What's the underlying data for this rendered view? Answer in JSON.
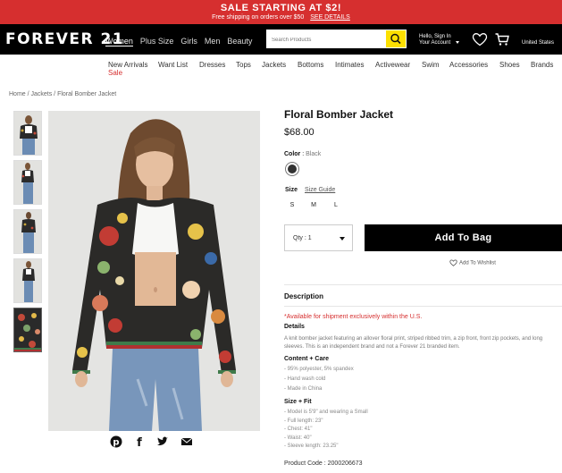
{
  "promo": {
    "headline": "SALE STARTING AT $2!",
    "subline": "Free shipping on orders over $50",
    "link": "SEE DETAILS"
  },
  "header": {
    "logo": "FOREVER 21",
    "categories": [
      "Women",
      "Plus Size",
      "Girls",
      "Men",
      "Beauty"
    ],
    "active_category": "Women",
    "search_placeholder": "Search Products",
    "account_line1": "Hello, Sign In",
    "account_line2": "Your Account",
    "country": "United States"
  },
  "subnav": {
    "items": [
      "New Arrivals",
      "Want List",
      "Dresses",
      "Tops",
      "Jackets",
      "Bottoms",
      "Intimates",
      "Activewear",
      "Swim",
      "Accessories",
      "Shoes",
      "Brands"
    ],
    "sale": "Sale"
  },
  "breadcrumb": "Home / Jackets / Floral Bomber Jacket",
  "product": {
    "title": "Floral Bomber Jacket",
    "price": "$68.00",
    "color_label": "Color",
    "color_value": "Black",
    "size_label": "Size",
    "size_guide": "Size Guide",
    "sizes": [
      "S",
      "M",
      "L"
    ],
    "qty_label": "Qty : 1",
    "add_to_bag": "Add To Bag",
    "wishlist": "Add To Wishlist"
  },
  "description": {
    "title": "Description",
    "availability_note": "*Available for shipment exclusively within the U.S.",
    "details_title": "Details",
    "details_text": "A knit bomber jacket featuring an allover floral print, striped ribbed trim, a zip front, front zip pockets, and long sleeves. This is an independent brand and not a Forever 21 branded item.",
    "content_title": "Content + Care",
    "content_items": [
      "- 95% polyester, 5% spandex",
      "- Hand wash cold",
      "- Made in China"
    ],
    "fit_title": "Size + Fit",
    "fit_items": [
      "- Model is 5'9\" and wearing a Small",
      "- Full length: 23\"",
      "- Chest: 41\"",
      "- Waist: 40\"",
      "- Sleeve length: 23.25\""
    ],
    "product_code": "Product Code : 2000206673"
  },
  "colors": {
    "promo_red": "#d62f2f",
    "search_yellow": "#fce000",
    "header_black": "#000000"
  }
}
